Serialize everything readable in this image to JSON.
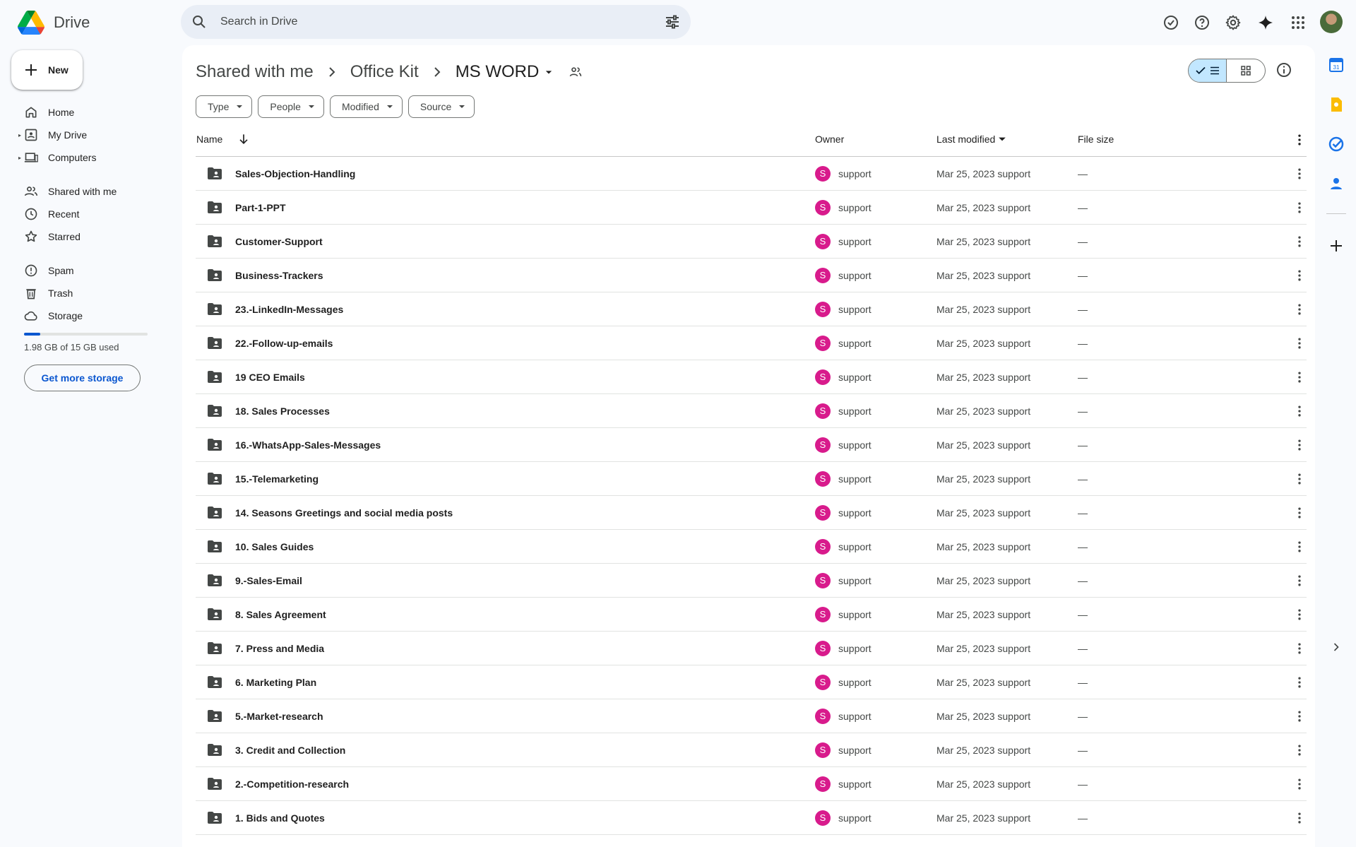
{
  "app": {
    "name": "Drive"
  },
  "search": {
    "placeholder": "Search in Drive"
  },
  "sidebar": {
    "new_label": "New",
    "items": [
      {
        "label": "Home",
        "icon": "home-icon"
      },
      {
        "label": "My Drive",
        "icon": "my-drive-icon"
      },
      {
        "label": "Computers",
        "icon": "computer-icon"
      },
      {
        "label": "Shared with me",
        "icon": "people-icon"
      },
      {
        "label": "Recent",
        "icon": "clock-icon"
      },
      {
        "label": "Starred",
        "icon": "star-icon"
      },
      {
        "label": "Spam",
        "icon": "spam-icon"
      },
      {
        "label": "Trash",
        "icon": "trash-icon"
      },
      {
        "label": "Storage",
        "icon": "cloud-icon"
      }
    ],
    "storage": {
      "used_text": "1.98 GB of 15 GB used",
      "fraction": 0.132,
      "button": "Get more storage"
    }
  },
  "breadcrumb": [
    "Shared with me",
    "Office Kit",
    "MS WORD"
  ],
  "filters": [
    "Type",
    "People",
    "Modified",
    "Source"
  ],
  "table": {
    "headers": {
      "name": "Name",
      "owner": "Owner",
      "modified": "Last modified",
      "size": "File size"
    },
    "rows": [
      {
        "name": "Sales-Objection-Handling",
        "owner_initial": "S",
        "owner": "support",
        "modified": "Mar 25, 2023 support",
        "size": "—"
      },
      {
        "name": "Part-1-PPT",
        "owner_initial": "S",
        "owner": "support",
        "modified": "Mar 25, 2023 support",
        "size": "—"
      },
      {
        "name": "Customer-Support",
        "owner_initial": "S",
        "owner": "support",
        "modified": "Mar 25, 2023 support",
        "size": "—"
      },
      {
        "name": "Business-Trackers",
        "owner_initial": "S",
        "owner": "support",
        "modified": "Mar 25, 2023 support",
        "size": "—"
      },
      {
        "name": "23.-LinkedIn-Messages",
        "owner_initial": "S",
        "owner": "support",
        "modified": "Mar 25, 2023 support",
        "size": "—"
      },
      {
        "name": "22.-Follow-up-emails",
        "owner_initial": "S",
        "owner": "support",
        "modified": "Mar 25, 2023 support",
        "size": "—"
      },
      {
        "name": "19 CEO Emails",
        "owner_initial": "S",
        "owner": "support",
        "modified": "Mar 25, 2023 support",
        "size": "—"
      },
      {
        "name": "18. Sales Processes",
        "owner_initial": "S",
        "owner": "support",
        "modified": "Mar 25, 2023 support",
        "size": "—"
      },
      {
        "name": "16.-WhatsApp-Sales-Messages",
        "owner_initial": "S",
        "owner": "support",
        "modified": "Mar 25, 2023 support",
        "size": "—"
      },
      {
        "name": "15.-Telemarketing",
        "owner_initial": "S",
        "owner": "support",
        "modified": "Mar 25, 2023 support",
        "size": "—"
      },
      {
        "name": "14. Seasons Greetings and social media posts",
        "owner_initial": "S",
        "owner": "support",
        "modified": "Mar 25, 2023 support",
        "size": "—"
      },
      {
        "name": "10. Sales Guides",
        "owner_initial": "S",
        "owner": "support",
        "modified": "Mar 25, 2023 support",
        "size": "—"
      },
      {
        "name": "9.-Sales-Email",
        "owner_initial": "S",
        "owner": "support",
        "modified": "Mar 25, 2023 support",
        "size": "—"
      },
      {
        "name": "8. Sales Agreement",
        "owner_initial": "S",
        "owner": "support",
        "modified": "Mar 25, 2023 support",
        "size": "—"
      },
      {
        "name": "7. Press and Media",
        "owner_initial": "S",
        "owner": "support",
        "modified": "Mar 25, 2023 support",
        "size": "—"
      },
      {
        "name": "6. Marketing Plan",
        "owner_initial": "S",
        "owner": "support",
        "modified": "Mar 25, 2023 support",
        "size": "—"
      },
      {
        "name": "5.-Market-research",
        "owner_initial": "S",
        "owner": "support",
        "modified": "Mar 25, 2023 support",
        "size": "—"
      },
      {
        "name": "3. Credit and Collection",
        "owner_initial": "S",
        "owner": "support",
        "modified": "Mar 25, 2023 support",
        "size": "—"
      },
      {
        "name": "2.-Competition-research",
        "owner_initial": "S",
        "owner": "support",
        "modified": "Mar 25, 2023 support",
        "size": "—"
      },
      {
        "name": "1. Bids and Quotes",
        "owner_initial": "S",
        "owner": "support",
        "modified": "Mar 25, 2023 support",
        "size": "—"
      }
    ]
  },
  "colors": {
    "accent": "#0b57d0",
    "owner_avatar": "#d81b8c",
    "selected_view": "#c2e7ff"
  }
}
